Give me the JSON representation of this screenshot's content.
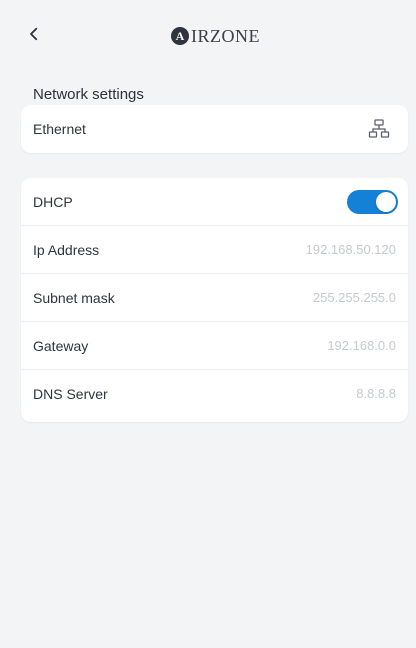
{
  "header": {
    "back_label": "<",
    "brand_logo_letter": "A",
    "brand_text": "IRZONE"
  },
  "network_settings": {
    "title": "Network settings",
    "ethernet_label": "Ethernet",
    "dhcp_label": "DHCP",
    "dhcp_enabled": true,
    "ip_address_label": "Ip Address",
    "ip_address_value": "192.168.50.120",
    "subnet_mask_label": "Subnet mask",
    "subnet_mask_value": "255.255.255.0",
    "gateway_label": "Gateway",
    "gateway_value": "192.168.0.0",
    "dns_server_label": "DNS Server",
    "dns_server_value": "8.8.8.8"
  },
  "icons": {
    "back": "chevron-left-icon",
    "ethernet": "network-icon"
  },
  "colors": {
    "background": "#f3f4f6",
    "card": "#ffffff",
    "accent": "#1481d7",
    "text_primary": "#2f333a",
    "text_secondary": "#c6c9cf"
  }
}
